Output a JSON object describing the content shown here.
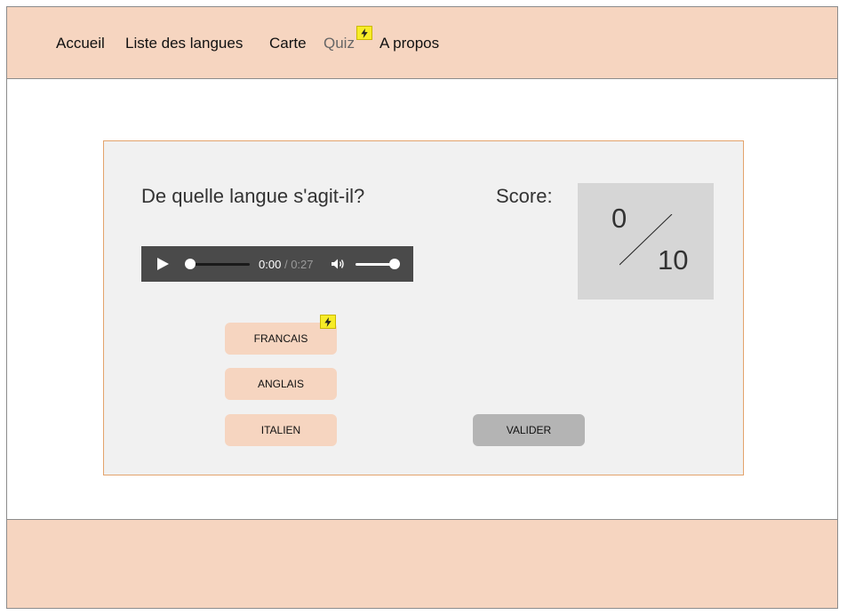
{
  "nav": {
    "items": [
      {
        "label": "Accueil"
      },
      {
        "label": "Liste des langues"
      },
      {
        "label": "Carte"
      },
      {
        "label": "Quiz"
      },
      {
        "label": "A propos"
      }
    ],
    "active": "Quiz"
  },
  "quiz": {
    "question": "De quelle langue s'agit-il?",
    "score_label": "Score:",
    "score_current": "0",
    "score_total": "10",
    "audio": {
      "current_time": "0:00",
      "separator": "/",
      "duration": "0:27",
      "progress": 0,
      "volume": 1
    },
    "options": [
      {
        "label": "FRANCAIS"
      },
      {
        "label": "ANGLAIS"
      },
      {
        "label": "ITALIEN"
      }
    ],
    "submit_label": "VALIDER"
  },
  "colors": {
    "header_bg": "#f6d5c0",
    "card_bg": "#f1f1f1",
    "card_border": "#e3a36c",
    "option_bg": "#f6d5c0",
    "submit_bg": "#b4b4b4",
    "badge": "#f7ec27"
  },
  "icons": [
    "lightning-icon",
    "play-icon",
    "volume-icon"
  ]
}
